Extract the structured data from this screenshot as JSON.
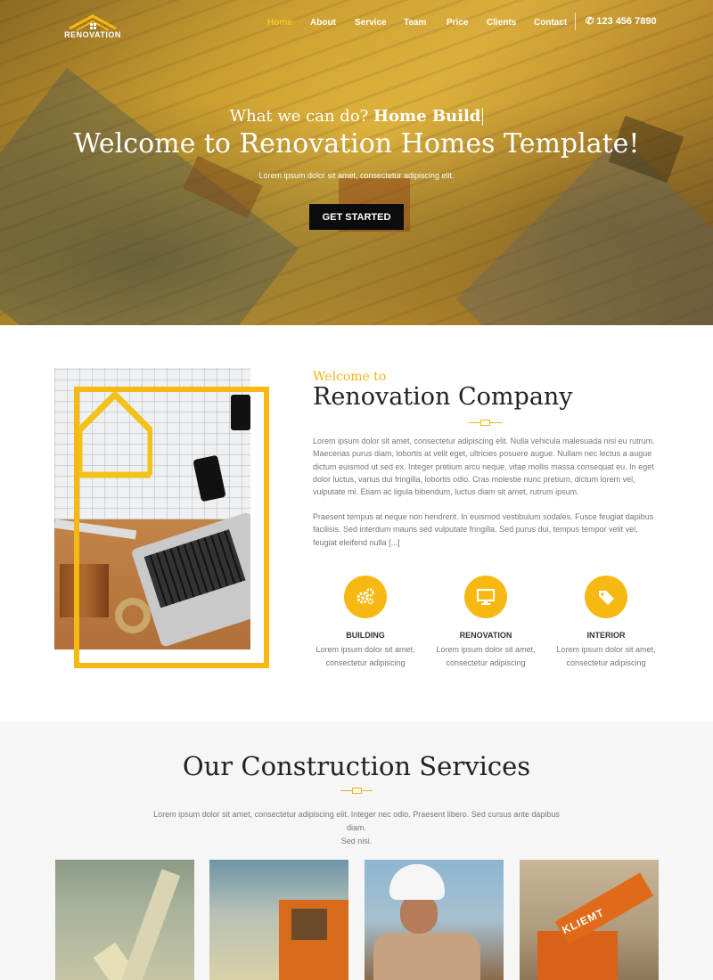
{
  "brand": {
    "logo_text": "RENOVATION"
  },
  "nav": {
    "items": [
      {
        "label": "Home",
        "active": true
      },
      {
        "label": "About",
        "active": false
      },
      {
        "label": "Service",
        "active": false
      },
      {
        "label": "Team",
        "active": false
      },
      {
        "label": "Price",
        "active": false
      },
      {
        "label": "Clients",
        "active": false
      },
      {
        "label": "Contact",
        "active": false
      }
    ],
    "phone": "123 456 7890"
  },
  "hero": {
    "tag_prefix": "What we can do?",
    "tag_highlight": "Home Build",
    "title": "Welcome to Renovation Homes Template!",
    "subtitle": "Lorem ipsum dolor sit amet, consectetur adipiscing elit.",
    "button": "GET STARTED"
  },
  "about": {
    "small_heading": "Welcome to",
    "heading": "Renovation Company",
    "paragraph1": "Lorem ipsum dolor sit amet, consectetur adipiscing elit. Nulla vehicula malesuada nisi eu rutrum. Maecenas purus diam, lobortis at velit eget, ultricies posuere augue. Nullam nec lectus a augue dictum euismod ut sed ex. Integer pretium arcu neque, vitae mollis massa consequat eu. In eget dolor luctus, varius dui fringilla, lobortis odio. Cras molestie nunc pretium, dictum lorem vel, vulputate mi. Etiam ac ligula bibendum, luctus diam sit amet, rutrum ipsum.",
    "paragraph2": "Praesent tempus at neque non hendrerit. In euismod vestibulum sodales. Fusce feugiat dapibus facilisis. Sed interdum mauris sed vulputate fringilla. Sed purus dui, tempus tempor velit vel, feugiat eleifend nulla [...]",
    "features": [
      {
        "icon": "gears-icon",
        "title": "BUILDING",
        "line1": "Lorem ipsum dolor sit amet,",
        "line2": "consectetur adipiscing"
      },
      {
        "icon": "monitor-icon",
        "title": "RENOVATION",
        "line1": "Lorem ipsum dolor sit amet,",
        "line2": "consectetur adipiscing"
      },
      {
        "icon": "tags-icon",
        "title": "INTERIOR",
        "line1": "Lorem ipsum dolor sit amet,",
        "line2": "consectetur adipiscing"
      }
    ]
  },
  "services": {
    "heading": "Our Construction Services",
    "description_line1": "Lorem ipsum dolor sit amet, consectetur adipiscing elit. Integer nec odio. Praesent libero. Sed cursus ante dapibus diam.",
    "description_line2": "Sed nisi.",
    "cards": [
      {
        "alt": "crane"
      },
      {
        "alt": "machine-cab"
      },
      {
        "alt": "worker"
      },
      {
        "alt": "excavator",
        "sign_text": "KLIEMT"
      }
    ]
  },
  "colors": {
    "accent": "#f7b812",
    "heading": "#222222",
    "body_text": "#777777",
    "nav_active": "#f7c42c"
  }
}
